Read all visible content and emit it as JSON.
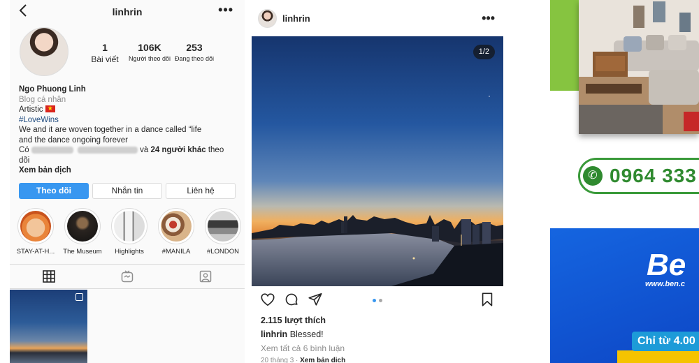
{
  "profile": {
    "username": "linhrin",
    "back_icon": "chevron-left-icon",
    "more_label": "•••",
    "stats": [
      {
        "value": "1",
        "label": "Bài viết"
      },
      {
        "value": "106K",
        "label": "Người theo dõi"
      },
      {
        "value": "253",
        "label": "Đang theo dõi"
      }
    ],
    "bio": {
      "name": "Ngo Phuong Linh",
      "category": "Blog cá nhân",
      "line1": "Artistic",
      "hashtag": "#LoveWins",
      "quote_line1": "We and it are woven together in a dance called “life",
      "quote_line2": "and the dance ongoing forever",
      "followed_prefix": "Có",
      "followed_suffix": "và",
      "followed_count": "24 người khác",
      "followed_tail": "theo",
      "followed_tail2": "dõi",
      "translate": "Xem bản dịch"
    },
    "buttons": {
      "follow": "Theo dõi",
      "message": "Nhắn tin",
      "contact": "Liên hệ"
    },
    "highlights": [
      {
        "label": "STAY-AT-H..."
      },
      {
        "label": "The Museum"
      },
      {
        "label": "Highlights"
      },
      {
        "label": "#MANILA"
      },
      {
        "label": "#LONDON"
      }
    ],
    "tabs": [
      "grid-icon",
      "igtv-icon",
      "tagged-icon"
    ]
  },
  "post": {
    "username": "linhrin",
    "more_label": "•••",
    "counter": "1/2",
    "likes": "2.115 lượt thích",
    "caption_user": "linhrin",
    "caption_text": "Blessed!",
    "view_comments": "Xem tất cả 6 bình luận",
    "date": "20 tháng 3",
    "date_sep": "·",
    "see_translation": "Xem bản dịch",
    "carousel_index": 1,
    "carousel_total": 2
  },
  "ads": {
    "phone": "0964 333",
    "phone_icon": "phone-icon",
    "ben_logo": "Be",
    "ben_url": "www.ben.c",
    "promo": "Chỉ từ 4.00"
  }
}
